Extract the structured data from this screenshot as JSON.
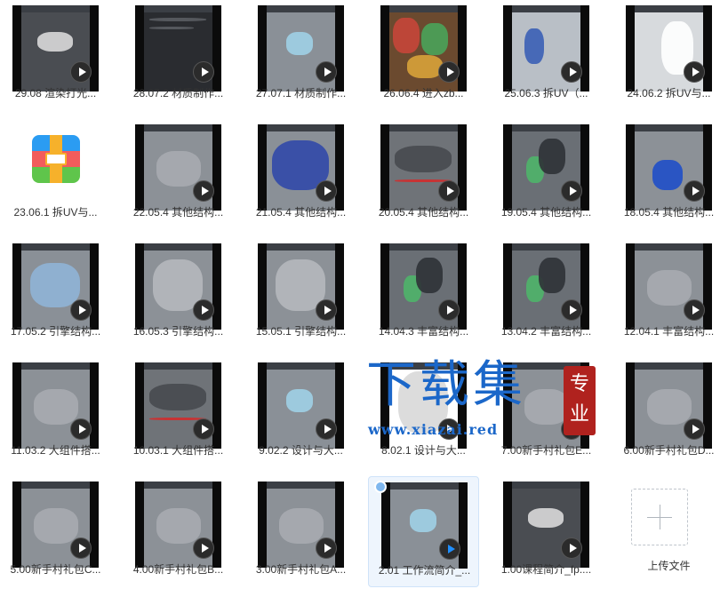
{
  "files": [
    {
      "label": "29.08 渲染打光...",
      "type": "video",
      "scene": "bike-dark"
    },
    {
      "label": "28.07.2 材质制作...",
      "type": "video",
      "scene": "ui-dark"
    },
    {
      "label": "27.07.1 材质制作...",
      "type": "video",
      "scene": "cube"
    },
    {
      "label": "26.06.4 进入zb...",
      "type": "video",
      "scene": "colorful"
    },
    {
      "label": "25.06.3 拆UV（...",
      "type": "video",
      "scene": "uv-blue"
    },
    {
      "label": "24.06.2 拆UV与...",
      "type": "video",
      "scene": "uv-numbers"
    },
    {
      "label": "23.06.1 拆UV与...",
      "type": "archive"
    },
    {
      "label": "22.05.4 其他结构...",
      "type": "video",
      "scene": "grey"
    },
    {
      "label": "21.05.4 其他结构...",
      "type": "video",
      "scene": "wire-blue"
    },
    {
      "label": "20.05.4 其他结构...",
      "type": "video",
      "scene": "red-line"
    },
    {
      "label": "19.05.4 其他结构...",
      "type": "video",
      "scene": "green-parts"
    },
    {
      "label": "18.05.4 其他结构...",
      "type": "video",
      "scene": "blue-box"
    },
    {
      "label": "17.05.2 引擎结构...",
      "type": "video",
      "scene": "engine-blue"
    },
    {
      "label": "16.05.3 引擎结构...",
      "type": "video",
      "scene": "engine-grey"
    },
    {
      "label": "15.05.1 引擎结构...",
      "type": "video",
      "scene": "engine-grey"
    },
    {
      "label": "14.04.3 丰富结构...",
      "type": "video",
      "scene": "green-parts"
    },
    {
      "label": "13.04.2 丰富结构...",
      "type": "video",
      "scene": "green-parts"
    },
    {
      "label": "12.04.1 丰富结构...",
      "type": "video",
      "scene": "grey"
    },
    {
      "label": "11.03.2 大组件搭...",
      "type": "video",
      "scene": "grey"
    },
    {
      "label": "10.03.1 大组件搭...",
      "type": "video",
      "scene": "red-line"
    },
    {
      "label": "9.02.2 设计与大...",
      "type": "video",
      "scene": "cube"
    },
    {
      "label": "8.02.1 设计与大...",
      "type": "video",
      "scene": "white"
    },
    {
      "label": "7.00新手村礼包E...",
      "type": "video",
      "scene": "grey"
    },
    {
      "label": "6.00新手村礼包D...",
      "type": "video",
      "scene": "grey"
    },
    {
      "label": "5.00新手村礼包C...",
      "type": "video",
      "scene": "grey"
    },
    {
      "label": "4.00新手村礼包B...",
      "type": "video",
      "scene": "grey"
    },
    {
      "label": "3.00新手村礼包A...",
      "type": "video",
      "scene": "grey"
    },
    {
      "label": "2.01 工作流简介_...",
      "type": "video",
      "scene": "cube",
      "selected": true
    },
    {
      "label": "1.00课程简介_fp....",
      "type": "video",
      "scene": "bike-dark"
    },
    {
      "label": "上传文件",
      "type": "upload"
    }
  ],
  "watermark": {
    "title": "下载集",
    "url": "www.xiazai.red",
    "seal": "专业"
  }
}
